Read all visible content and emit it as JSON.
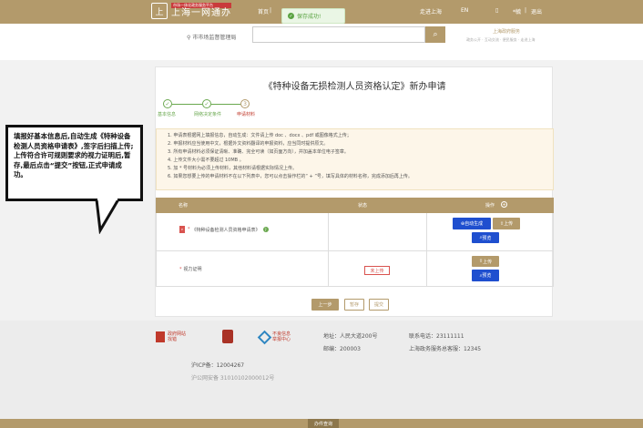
{
  "header": {
    "logo_small": "市场一体化政务服务平台",
    "logo_big": "上海一网通办",
    "logo_emblem": "上",
    "nav": [
      "首页",
      "走进上海",
      "EN"
    ],
    "user": "*毓",
    "logout": "退出",
    "toast": "保存成功!"
  },
  "search": {
    "location": "市市场监督管理局",
    "placeholder": "",
    "slogan": "上海政府服务",
    "slogan_sub": "政务公开 · 互动交流 · 便民服务 · 走进上海"
  },
  "page": {
    "title": "《特种设备无损检测人员资格认定》新办申请",
    "steps": [
      {
        "label": "基本信息",
        "mark": "✓"
      },
      {
        "label": "网络决定条件",
        "mark": "✓"
      },
      {
        "label": "申请材料",
        "mark": "3"
      }
    ],
    "notes": [
      "1. 申请表根据网上填报信息，自动生成：文件请上传 doc 、docx 、pdf 或图像格式上传；",
      "2. 申报材料应当使用中文，根据外文资料翻译的申报资料，应当同时提供原文。",
      "3. 所有申请材料必须保证清晰、准确、完全可读（如页面方向），并加盖本单位电子签章。",
      "4. 上传文件大小需不要超过 10MB 。",
      "5. 加 * 号材料为必须上传材料，其他材料请根据实际情况上传。",
      "6. 如果您想要上传的申请材料不在以下列表中，您可以点击操作栏的“ + ”号，填写具体的材料名称，完成添加后再上传。"
    ],
    "table": {
      "headers": [
        "名称",
        "状态",
        "操作"
      ],
      "add_icon": "+",
      "rows": [
        {
          "name": "《特种设备检测人员资格申请表》",
          "status": "",
          "actions": [
            "自动生成",
            "上传",
            "预览"
          ]
        },
        {
          "name": "视力证明",
          "status": "未上传",
          "actions": [
            "上传",
            "预览"
          ]
        }
      ]
    },
    "buttons": {
      "prev": "上一步",
      "save": "暂存",
      "submit": "提交"
    }
  },
  "footer": {
    "logo1": "政府网站 找错",
    "logo3": "不良信息 举报中心",
    "address": "地址：人民大道200号",
    "postcode": "邮编：200003",
    "phone": "联系电话：23111111",
    "hotline": "上海政务服务总客服：12345",
    "icp": "沪ICP备：12004267",
    "police": "沪公网安备 31010102000012号",
    "bar_label": "办件查询"
  },
  "annotation": {
    "text": "填报好基本信息后,自动生成《特种设备检测人员资格申请表》,签字后扫描上传;上传符合许可规则要求的视力证明后,暂存,最后点击“提交”按钮,正式申请成功。"
  }
}
